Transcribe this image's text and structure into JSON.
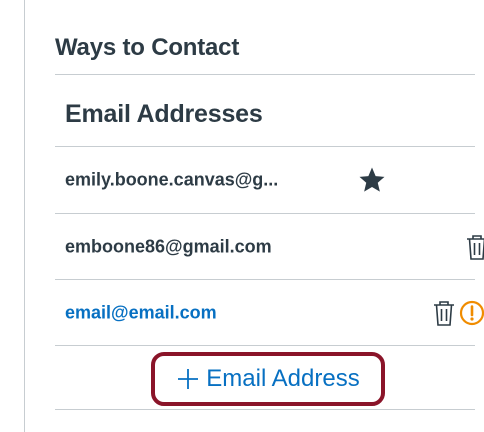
{
  "section": {
    "title": "Ways to Contact"
  },
  "email_addresses": {
    "heading": "Email Addresses",
    "items": [
      {
        "address": "emily.boone.canvas@g...",
        "default": true
      },
      {
        "address": "emboone86@gmail.com",
        "default": false
      },
      {
        "address": "email@email.com",
        "default": false,
        "unconfirmed": true
      }
    ],
    "add_label": "Email Address"
  },
  "colors": {
    "text": "#2d3b45",
    "link": "#0770c2",
    "warning": "#f08c00",
    "highlight_border": "#8a1429",
    "divider": "#c7cdd1"
  },
  "icons": {
    "default_marker": "star-icon",
    "delete": "trash-icon",
    "warning": "warning-icon",
    "add": "plus-icon"
  }
}
